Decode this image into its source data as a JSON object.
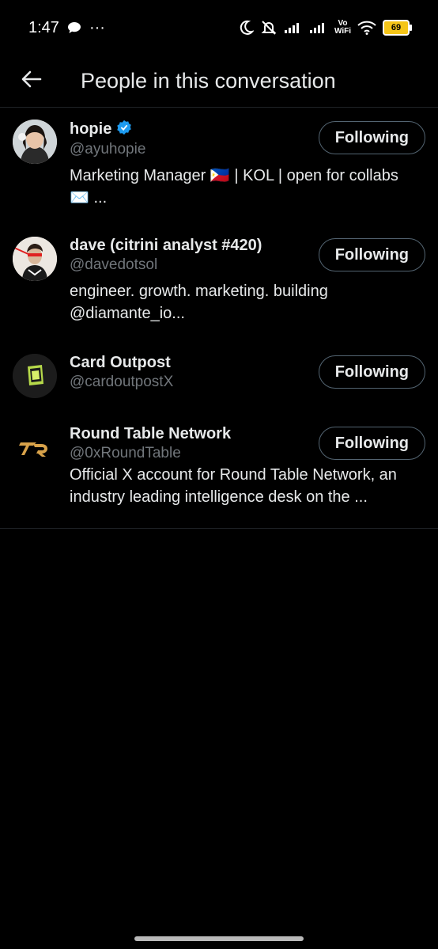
{
  "status_bar": {
    "time": "1:47",
    "dots": "···",
    "battery": "69",
    "vo": "Vo",
    "wifi": "WiFi"
  },
  "header": {
    "title": "People in this conversation"
  },
  "people": [
    {
      "name": "hopie",
      "verified": true,
      "handle": "@ayuhopie",
      "bio": "Marketing Manager 🇵🇭 | KOL | open for collabs ✉️ ...",
      "button": "Following"
    },
    {
      "name": "dave (citrini analyst #420)",
      "verified": false,
      "handle": "@davedotsol",
      "bio": "engineer. growth. marketing. building @diamante_io...",
      "button": "Following"
    },
    {
      "name": "Card Outpost",
      "verified": false,
      "handle": "@cardoutpostX",
      "bio": "",
      "button": "Following"
    },
    {
      "name": "Round Table Network",
      "verified": false,
      "handle": "@0xRoundTable",
      "bio": "Official X account for Round Table Network, an industry leading intelligence desk on the ...",
      "button": "Following"
    }
  ],
  "colors": {
    "background": "#000000",
    "text": "#e7e9ea",
    "secondary": "#71767b",
    "verified": "#1d9bf0",
    "button_border": "#536471"
  }
}
